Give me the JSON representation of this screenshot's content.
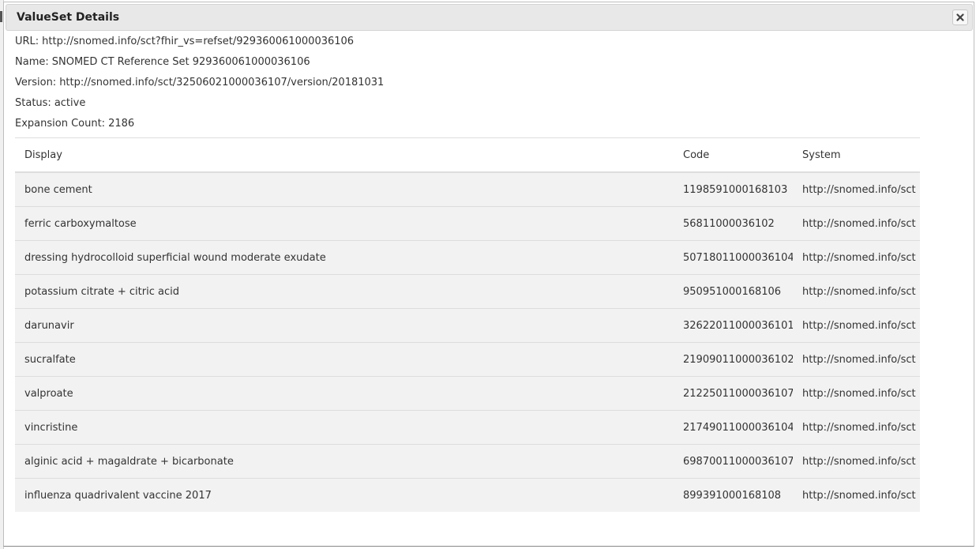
{
  "dialog": {
    "title": "ValueSet Details",
    "close_icon": "close-icon"
  },
  "meta": {
    "url_label": "URL:",
    "url_value": "http://snomed.info/sct?fhir_vs=refset/929360061000036106",
    "name_label": "Name:",
    "name_value": "SNOMED CT Reference Set 929360061000036106",
    "version_label": "Version:",
    "version_value": "http://snomed.info/sct/32506021000036107/version/20181031",
    "status_label": "Status:",
    "status_value": "active",
    "count_label": "Expansion Count:",
    "count_value": "2186"
  },
  "table": {
    "headers": {
      "display": "Display",
      "code": "Code",
      "system": "System"
    },
    "rows": [
      {
        "display": "bone cement",
        "code": "1198591000168103",
        "system": "http://snomed.info/sct"
      },
      {
        "display": "ferric carboxymaltose",
        "code": "56811000036102",
        "system": "http://snomed.info/sct"
      },
      {
        "display": "dressing hydrocolloid superficial wound moderate exudate",
        "code": "50718011000036104",
        "system": "http://snomed.info/sct"
      },
      {
        "display": "potassium citrate + citric acid",
        "code": "950951000168106",
        "system": "http://snomed.info/sct"
      },
      {
        "display": "darunavir",
        "code": "32622011000036101",
        "system": "http://snomed.info/sct"
      },
      {
        "display": "sucralfate",
        "code": "21909011000036102",
        "system": "http://snomed.info/sct"
      },
      {
        "display": "valproate",
        "code": "21225011000036107",
        "system": "http://snomed.info/sct"
      },
      {
        "display": "vincristine",
        "code": "21749011000036104",
        "system": "http://snomed.info/sct"
      },
      {
        "display": "alginic acid + magaldrate + bicarbonate",
        "code": "69870011000036107",
        "system": "http://snomed.info/sct"
      },
      {
        "display": "influenza quadrivalent vaccine 2017",
        "code": "899391000168108",
        "system": "http://snomed.info/sct"
      }
    ]
  }
}
